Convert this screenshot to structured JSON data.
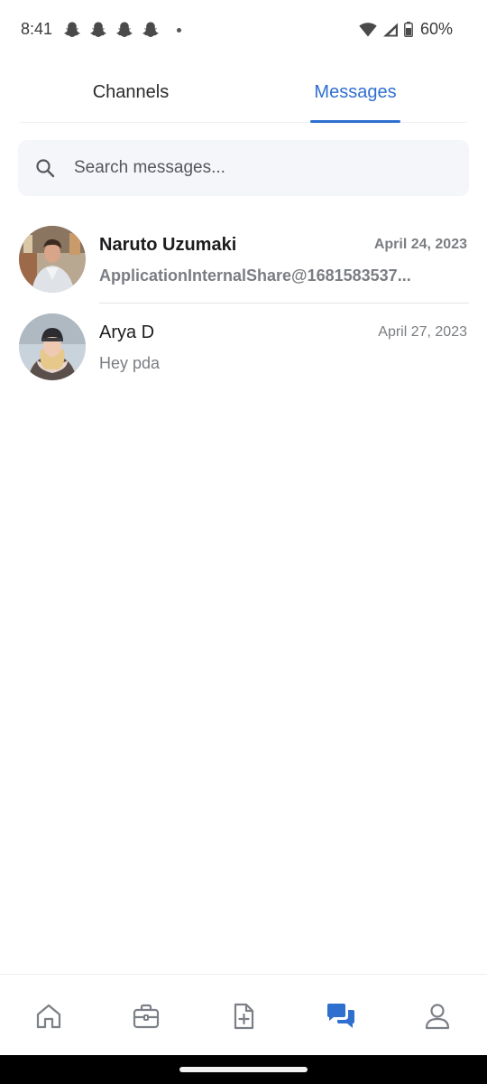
{
  "status_bar": {
    "time": "8:41",
    "notification_icons": [
      "snapchat-icon",
      "snapchat-icon",
      "snapchat-icon",
      "snapchat-icon"
    ],
    "battery": "60%"
  },
  "tabs": [
    {
      "label": "Channels",
      "active": false
    },
    {
      "label": "Messages",
      "active": true
    }
  ],
  "search": {
    "placeholder": "Search messages...",
    "value": ""
  },
  "conversations": [
    {
      "name": "Naruto Uzumaki",
      "date": "April 24, 2023",
      "preview": "ApplicationInternalShare@1681583537...",
      "unread": true
    },
    {
      "name": "Arya D",
      "date": "April 27, 2023",
      "preview": "Hey pda",
      "unread": false
    }
  ],
  "bottom_nav": [
    {
      "icon": "home-icon",
      "active": false
    },
    {
      "icon": "briefcase-icon",
      "active": false
    },
    {
      "icon": "document-add-icon",
      "active": false
    },
    {
      "icon": "chat-bubbles-icon",
      "active": true
    },
    {
      "icon": "user-icon",
      "active": false
    }
  ],
  "colors": {
    "accent": "#2f6fd0",
    "icon_inactive": "#7b7f86",
    "search_bg": "#f5f6fa"
  }
}
